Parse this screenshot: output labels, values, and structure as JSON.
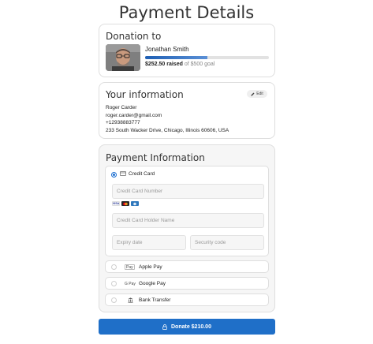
{
  "page": {
    "title": "Payment Details"
  },
  "donation": {
    "section_title": "Donation to",
    "recipient_name": "Jonathan Smith",
    "raised_amount": "$252.50 raised",
    "goal_text": "of $500 goal",
    "progress_fraction": 0.505,
    "progress_color": "#1e5fb4"
  },
  "info": {
    "section_title": "Your information",
    "edit_label": "Edit",
    "name": "Roger Carder",
    "email": "roger.carder@gmail.com",
    "phone": "+12938883777",
    "address": "233 South Wacker Drive, Chicago, Illinois 60606, USA"
  },
  "payment": {
    "section_title": "Payment Information",
    "methods": [
      {
        "label": "Credit Card",
        "icon": "credit-card-icon",
        "selected": true
      },
      {
        "label": "Apple Pay",
        "icon": "apple-pay-icon",
        "icon_text": "Pay",
        "selected": false
      },
      {
        "label": "Google Pay",
        "icon": "google-pay-icon",
        "icon_text": "G Pay",
        "selected": false
      },
      {
        "label": "Bank Transfer",
        "icon": "bank-icon",
        "selected": false
      }
    ],
    "card_logos": [
      {
        "name": "visa-logo",
        "text": "VISA"
      },
      {
        "name": "mastercard-logo"
      },
      {
        "name": "amex-logo"
      }
    ],
    "fields": {
      "card_number_placeholder": "Credit Card Number",
      "holder_placeholder": "Credit Card Holder Name",
      "expiry_placeholder": "Expiry date",
      "security_placeholder": "Security code"
    }
  },
  "donate": {
    "label": "Donate $210.00",
    "color": "#1f6fc8"
  }
}
